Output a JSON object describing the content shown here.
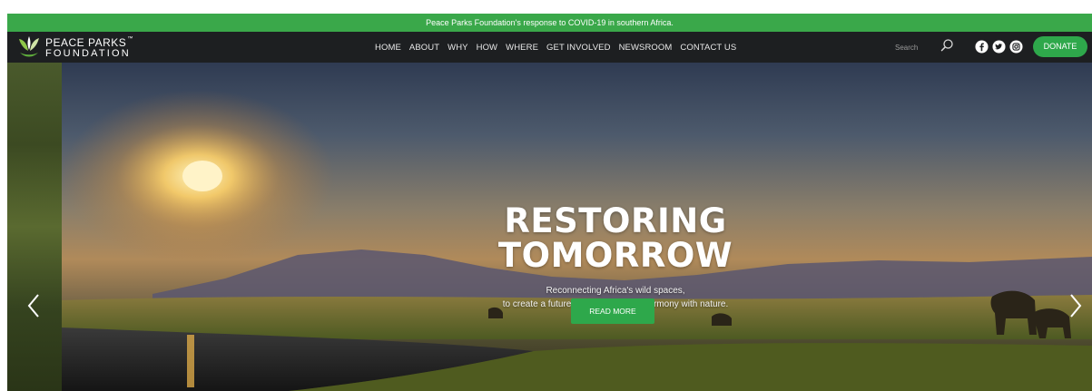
{
  "announcement": {
    "text": "Peace Parks Foundation's response to COVID-19 in southern Africa."
  },
  "logo": {
    "line1": "PEACE PARKS",
    "tm": "™",
    "line2": "FOUNDATION"
  },
  "nav": {
    "links": [
      {
        "label": "HOME"
      },
      {
        "label": "ABOUT"
      },
      {
        "label": "WHY"
      },
      {
        "label": "HOW"
      },
      {
        "label": "WHERE"
      },
      {
        "label": "GET INVOLVED"
      },
      {
        "label": "NEWSROOM"
      },
      {
        "label": "CONTACT US"
      }
    ]
  },
  "search": {
    "placeholder": "Search"
  },
  "social": {
    "icons": [
      "facebook-icon",
      "twitter-icon",
      "instagram-icon"
    ]
  },
  "donate": {
    "label": "DONATE"
  },
  "hero": {
    "headline_line1": "RESTORING",
    "headline_line2": "TOMORROW",
    "sub_line1": "Reconnecting Africa's wild spaces,",
    "sub_line2": "to create a future for humankind in harmony with nature.",
    "cta_label": "READ MORE"
  },
  "colors": {
    "brand_green": "#2ea84b",
    "announcement_bar": "#3aa84a",
    "nav_background": "#1d1f21",
    "text_light": "#ffffff"
  }
}
